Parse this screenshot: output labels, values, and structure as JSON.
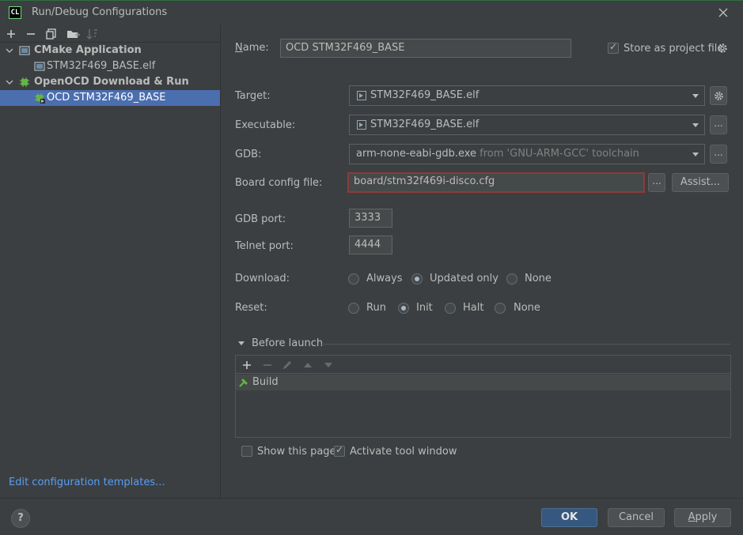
{
  "window": {
    "app_icon_text": "CL",
    "title": "Run/Debug Configurations"
  },
  "tree": {
    "groups": [
      {
        "label": "CMake Application",
        "items": [
          {
            "label": "STM32F469_BASE.elf"
          }
        ]
      },
      {
        "label": "OpenOCD Download & Run",
        "items": [
          {
            "label": "OCD STM32F469_BASE",
            "selected": true
          }
        ]
      }
    ],
    "edit_templates_link": "Edit configuration templates..."
  },
  "form": {
    "name_label": "Name:",
    "name_value": "OCD STM32F469_BASE",
    "store_label": "Store as project file",
    "store_checked": true,
    "target_label": "Target:",
    "target_value": "STM32F469_BASE.elf",
    "executable_label": "Executable:",
    "executable_value": "STM32F469_BASE.elf",
    "gdb_label": "GDB:",
    "gdb_value": "arm-none-eabi-gdb.exe",
    "gdb_hint": "from 'GNU-ARM-GCC' toolchain",
    "board_label": "Board config file:",
    "board_value": "board/stm32f469i-disco.cfg",
    "browse_label": "...",
    "assist_label": "Assist...",
    "gdb_port_label": "GDB port:",
    "gdb_port_value": "3333",
    "telnet_port_label": "Telnet port:",
    "telnet_port_value": "4444",
    "download_label": "Download:",
    "download_options": [
      "Always",
      "Updated only",
      "None"
    ],
    "download_selected": "Updated only",
    "reset_label": "Reset:",
    "reset_options": [
      "Run",
      "Init",
      "Halt",
      "None"
    ],
    "reset_selected": "Init"
  },
  "before_launch": {
    "title": "Before launch",
    "tasks": [
      "Build"
    ],
    "show_page_label": "Show this page",
    "show_page_checked": false,
    "activate_label": "Activate tool window",
    "activate_checked": true
  },
  "buttons": {
    "help": "?",
    "ok": "OK",
    "cancel": "Cancel",
    "apply": "Apply"
  },
  "colors": {
    "background": "#3c3f41",
    "selection": "#4b6eaf",
    "link": "#589df6",
    "primary_button": "#365880",
    "error_border": "#8b3b3b"
  }
}
